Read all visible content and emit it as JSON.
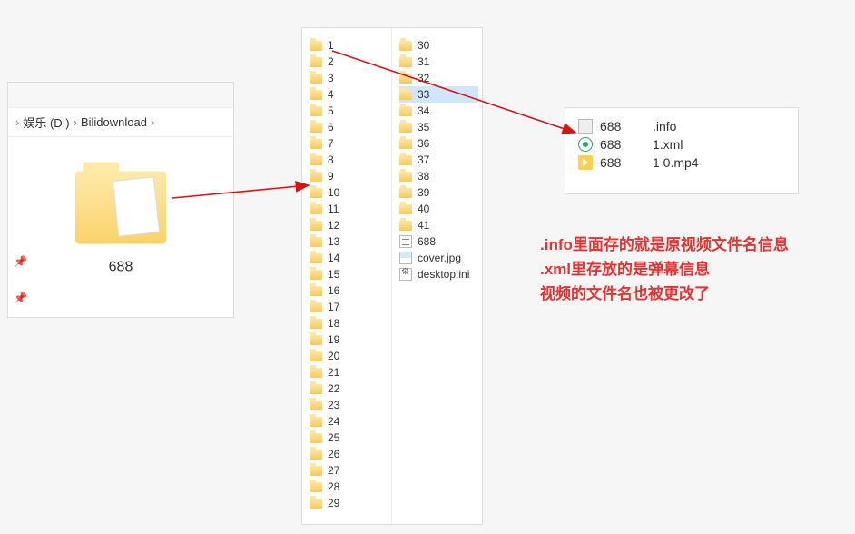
{
  "breadcrumb": {
    "part1": "娱乐 (D:)",
    "part2": "Bilidownload"
  },
  "big_folder_label": "688",
  "columns": {
    "left": [
      {
        "name": "1",
        "type": "folder"
      },
      {
        "name": "2",
        "type": "folder"
      },
      {
        "name": "3",
        "type": "folder"
      },
      {
        "name": "4",
        "type": "folder"
      },
      {
        "name": "5",
        "type": "folder"
      },
      {
        "name": "6",
        "type": "folder"
      },
      {
        "name": "7",
        "type": "folder"
      },
      {
        "name": "8",
        "type": "folder"
      },
      {
        "name": "9",
        "type": "folder"
      },
      {
        "name": "10",
        "type": "folder"
      },
      {
        "name": "11",
        "type": "folder"
      },
      {
        "name": "12",
        "type": "folder"
      },
      {
        "name": "13",
        "type": "folder"
      },
      {
        "name": "14",
        "type": "folder"
      },
      {
        "name": "15",
        "type": "folder"
      },
      {
        "name": "16",
        "type": "folder"
      },
      {
        "name": "17",
        "type": "folder"
      },
      {
        "name": "18",
        "type": "folder"
      },
      {
        "name": "19",
        "type": "folder"
      },
      {
        "name": "20",
        "type": "folder"
      },
      {
        "name": "21",
        "type": "folder"
      },
      {
        "name": "22",
        "type": "folder"
      },
      {
        "name": "23",
        "type": "folder"
      },
      {
        "name": "24",
        "type": "folder"
      },
      {
        "name": "25",
        "type": "folder"
      },
      {
        "name": "26",
        "type": "folder"
      },
      {
        "name": "27",
        "type": "folder"
      },
      {
        "name": "28",
        "type": "folder"
      },
      {
        "name": "29",
        "type": "folder"
      }
    ],
    "right": [
      {
        "name": "30",
        "type": "folder"
      },
      {
        "name": "31",
        "type": "folder"
      },
      {
        "name": "32",
        "type": "folder"
      },
      {
        "name": "33",
        "type": "folder",
        "selected": true
      },
      {
        "name": "34",
        "type": "folder"
      },
      {
        "name": "35",
        "type": "folder"
      },
      {
        "name": "36",
        "type": "folder"
      },
      {
        "name": "37",
        "type": "folder"
      },
      {
        "name": "38",
        "type": "folder"
      },
      {
        "name": "39",
        "type": "folder"
      },
      {
        "name": "40",
        "type": "folder"
      },
      {
        "name": "41",
        "type": "folder"
      },
      {
        "name": "688",
        "type": "txt"
      },
      {
        "name": "cover.jpg",
        "type": "img"
      },
      {
        "name": "desktop.ini",
        "type": "ini"
      }
    ]
  },
  "detail_files": [
    {
      "icon": "info",
      "name": "688",
      "ext": ".info"
    },
    {
      "icon": "xml",
      "name": "688",
      "ext": "1.xml"
    },
    {
      "icon": "mp4",
      "name": "688",
      "ext": "1 0.mp4"
    }
  ],
  "notes": {
    "line1": ".info里面存的就是原视频文件名信息",
    "line2": ".xml里存放的是弹幕信息",
    "line3": "视频的文件名也被更改了"
  },
  "arrow_color": "#d11"
}
